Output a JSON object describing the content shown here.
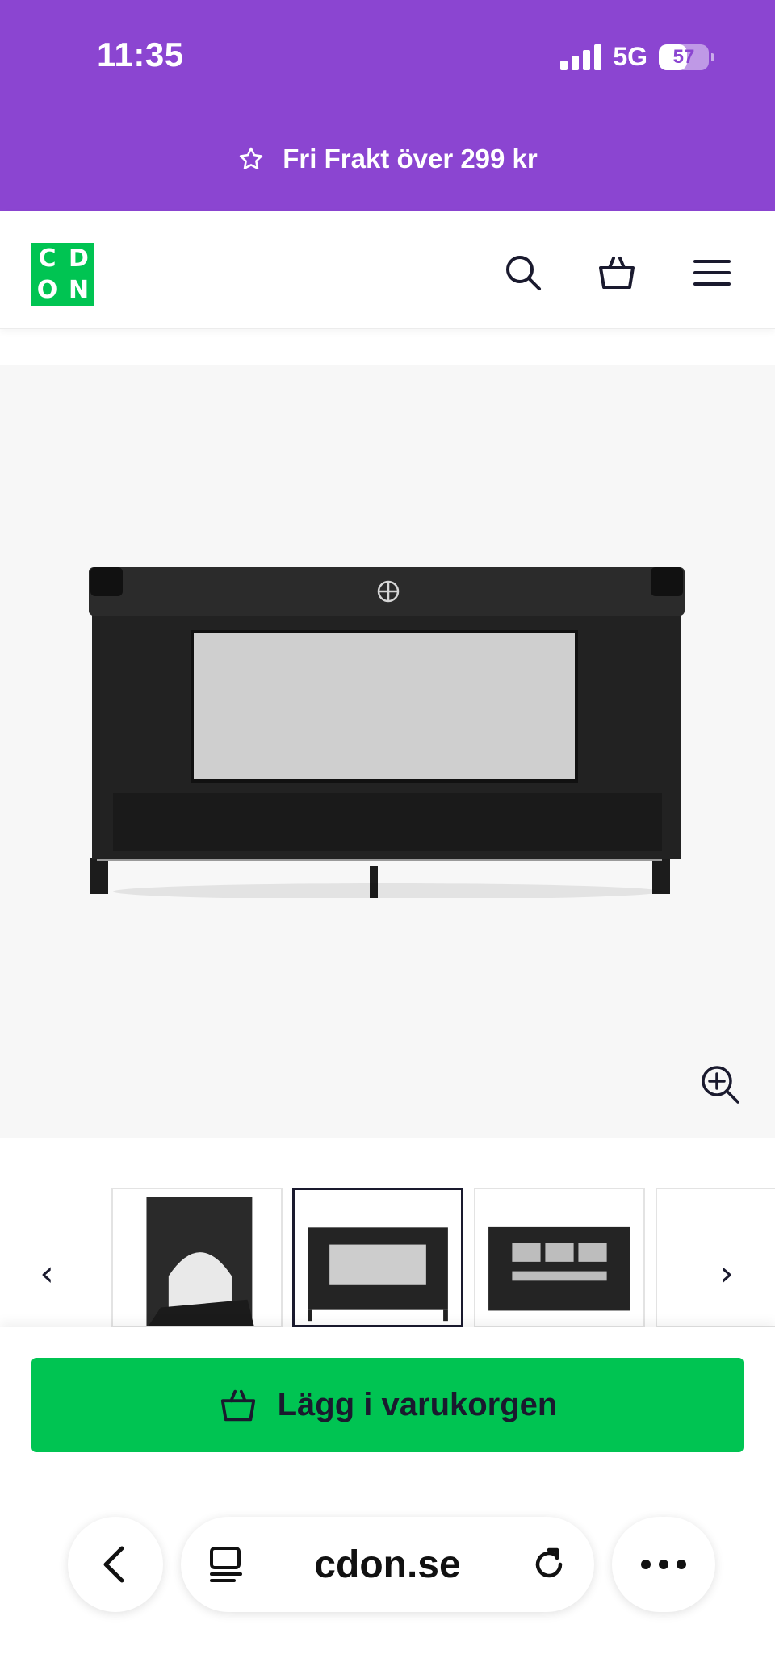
{
  "colors": {
    "brand_purple": "#8b45d1",
    "brand_green": "#00c452",
    "text_dark": "#1a1a2e"
  },
  "status_bar": {
    "time": "11:35",
    "network": "5G",
    "battery": "57",
    "battery_level": 0.57
  },
  "promo": {
    "icon": "star-outline-icon",
    "text": "Fri Frakt över 299 kr"
  },
  "header": {
    "logo_letters": [
      "C",
      "D",
      "O",
      "N"
    ],
    "icons": [
      "search-icon",
      "basket-icon",
      "menu-icon"
    ]
  },
  "gallery": {
    "zoom_icon": "zoom-in-icon",
    "thumbnails": [
      {
        "name": "thumb-crib-side-door",
        "active": false
      },
      {
        "name": "thumb-crib-front",
        "active": true
      },
      {
        "name": "thumb-crib-mesh",
        "active": false
      }
    ],
    "prev_arrow": "‹",
    "next_arrow": "›"
  },
  "add_to_cart": {
    "label": "Lägg i varukorgen",
    "icon": "basket-icon"
  },
  "browser": {
    "url": "cdon.se",
    "icons": [
      "back-chevron-icon",
      "tabs-icon",
      "reload-icon",
      "more-icon"
    ]
  }
}
